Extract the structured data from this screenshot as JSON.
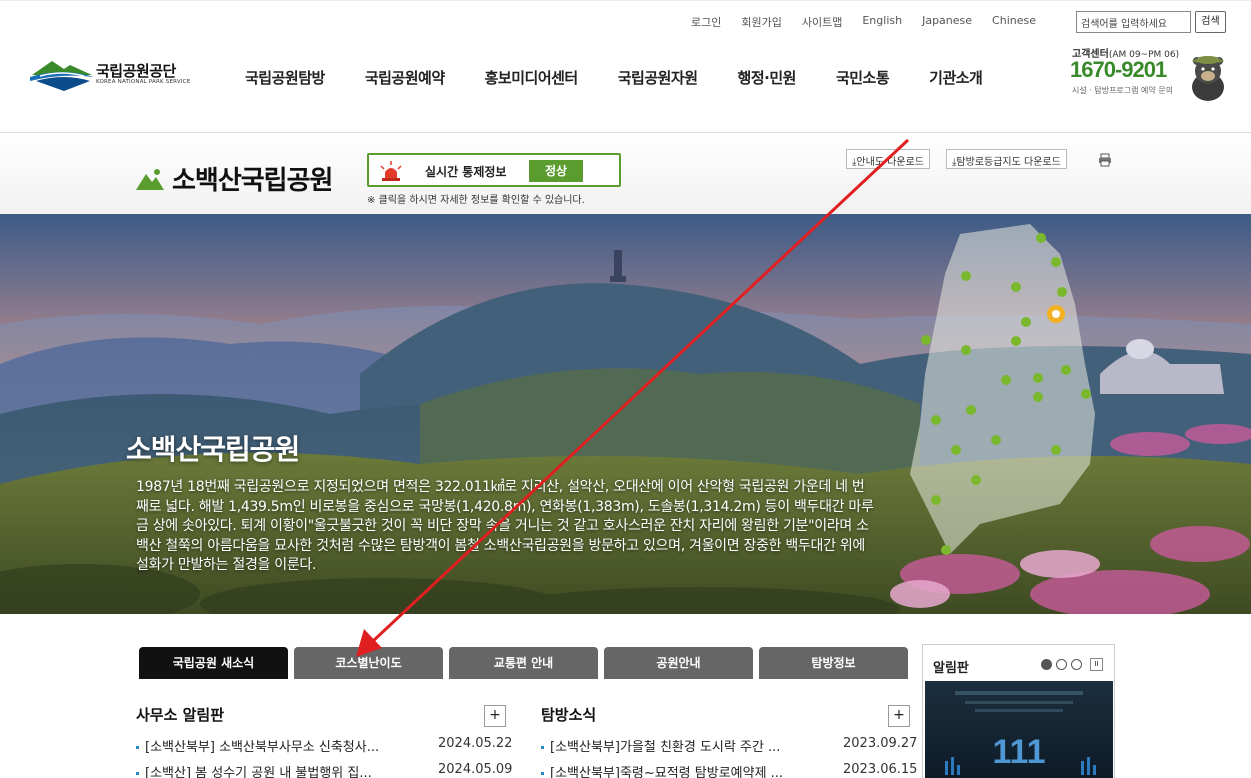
{
  "util_links": [
    "로그인",
    "회원가입",
    "사이트맵",
    "English",
    "Japanese",
    "Chinese"
  ],
  "search": {
    "placeholder": "검색어를 입력하세요",
    "button": "검색"
  },
  "logo": {
    "kr": "국립공원공단",
    "en": "KOREA NATIONAL PARK SERVICE"
  },
  "gnb": [
    "국립공원탐방",
    "국립공원예약",
    "홍보미디어센터",
    "국립공원자원",
    "행정·민원",
    "국민소통",
    "기관소개"
  ],
  "customer_center": {
    "title": "고객센터",
    "hours": "(AM 09~PM 06)",
    "phone": "1670-9201",
    "sub": "시설 · 탐방프로그램 예약 문의"
  },
  "park": {
    "title": "소백산국립공원",
    "status_label": "실시간 통제정보",
    "status_value": "정상",
    "status_note": "※ 클릭을 하시면 자세한 정보를 확인할 수 있습니다.",
    "download_map": "안내도 다운로드",
    "download_grade": "탐방로등급지도 다운로드"
  },
  "hero": {
    "title": "소백산국립공원",
    "description": "1987년 18번째 국립공원으로 지정되었으며 면적은 322.011㎢로 지리산, 설악산, 오대산에 이어 산악형 국립공원 가운데 네 번째로 넓다. 해발 1,439.5m인 비로봉을 중심으로 국망봉(1,420.8m), 연화봉(1,383m), 도솔봉(1,314.2m) 등이 백두대간 마루금 상에 솟아있다. 퇴계 이황이\"울긋불긋한 것이 꼭 비단 장막 속을 거니는 것 같고 호사스러운 잔치 자리에 왕림한 기분\"이라며 소백산 철쭉의 아름다움을 묘사한 것처럼 수많은 탐방객이 봄철 소백산국립공원을 방문하고 있으며, 겨울이면 장중한 백두대간 위에 설화가 만발하는 절경을 이룬다."
  },
  "tabs": [
    "국립공원 새소식",
    "코스별난이도",
    "교통편 안내",
    "공원안내",
    "탐방정보"
  ],
  "office_board": {
    "title": "사무소 알림판",
    "plus": "+",
    "rows": [
      {
        "text": "[소백산북부] 소백산북부사무소 신축청사...",
        "date": "2024.05.22"
      },
      {
        "text": "[소백산] 봄 성수기 공원 내 불법행위 집...",
        "date": "2024.05.09"
      }
    ]
  },
  "trail_board": {
    "title": "탐방소식",
    "plus": "+",
    "rows": [
      {
        "text": "[소백산북부]가을철 친환경 도시락 주간 ...",
        "date": "2023.09.27"
      },
      {
        "text": "[소백산북부]죽령~묘적령 탐방로예약제 ...",
        "date": "2023.06.15"
      }
    ]
  },
  "notice": {
    "title": "알림판",
    "pause": "II"
  },
  "colors": {
    "accent_green": "#5a9c2e",
    "phone_green": "#3a8a2c",
    "arrow_red": "#e02020",
    "tab_dark": "#111111",
    "tab_gray": "#666666"
  }
}
